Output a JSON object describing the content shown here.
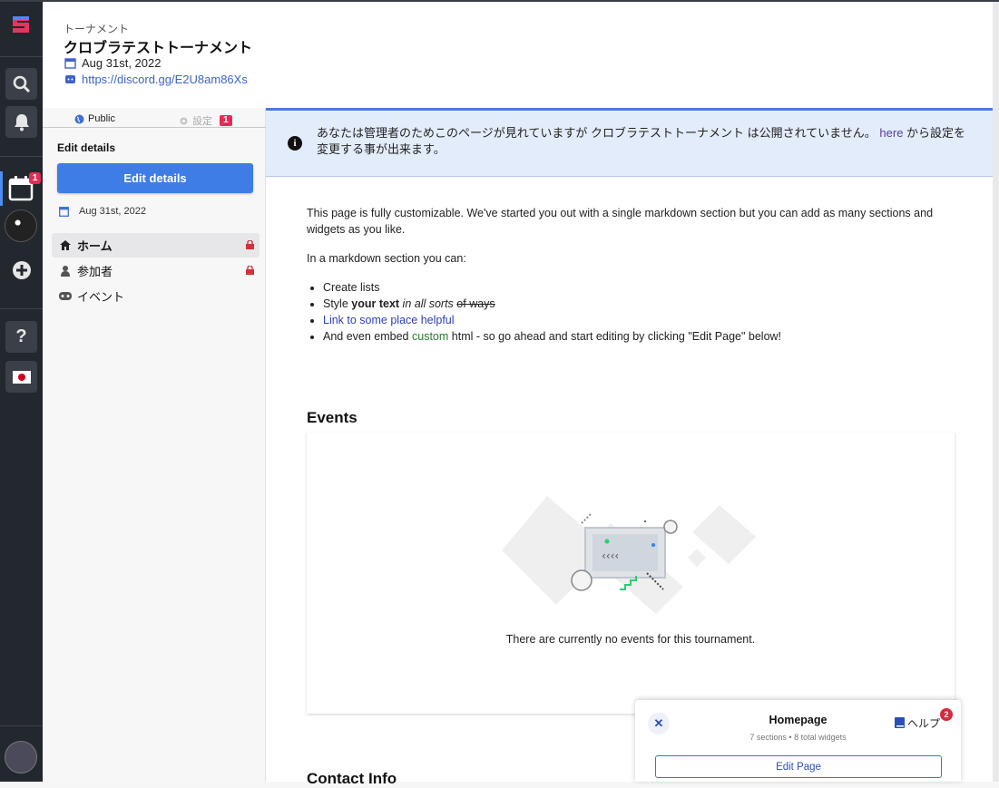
{
  "rail": {
    "notif_badge": "1"
  },
  "header": {
    "kind": "トーナメント",
    "title": "クロブラテストトーナメント",
    "date": "Aug 31st, 2022",
    "link": "https://discord.gg/E2U8am86Xs"
  },
  "sidebar": {
    "tab_public": "Public",
    "tab_settings": "設定",
    "settings_badge": "1",
    "edit_title": "Edit details",
    "edit_button": "Edit details",
    "date": "Aug 31st, 2022",
    "nav": [
      {
        "label": "ホーム",
        "locked": true
      },
      {
        "label": "参加者",
        "locked": true
      },
      {
        "label": "イベント",
        "locked": false
      }
    ]
  },
  "banner": {
    "before": "あなたは管理者のためこのページが見れていますが クロブラテストトーナメント は公開されていません。 ",
    "link": "here",
    "after": " から設定を変更する事が出来ます。"
  },
  "content": {
    "intro": "This page is fully customizable. We've started you out with a single markdown section but you can add as many sections and widgets as you like.",
    "lead": "In a markdown section you can:",
    "item1": "Create lists",
    "item2_a": "Style ",
    "item2_b": "your text",
    "item2_c": " in all sorts",
    "item2_d": "of ways",
    "item3": "Link to some place helpful",
    "item4_a": "And even embed ",
    "item4_b": "custom",
    "item4_c": " html - so go ahead and start editing by clicking \"Edit Page\" below!"
  },
  "events": {
    "heading": "Events",
    "empty": "There are currently no events for this tournament."
  },
  "contact": {
    "heading": "Contact Info"
  },
  "widget": {
    "title": "Homepage",
    "subtitle": "7 sections • 8 total widgets",
    "help": "ヘルプ",
    "help_badge": "2",
    "edit_page": "Edit Page"
  },
  "colors": {
    "accent": "#3f7de6",
    "rail": "#23272e",
    "banner": "#e3ecfa",
    "badge": "#e12d56"
  }
}
